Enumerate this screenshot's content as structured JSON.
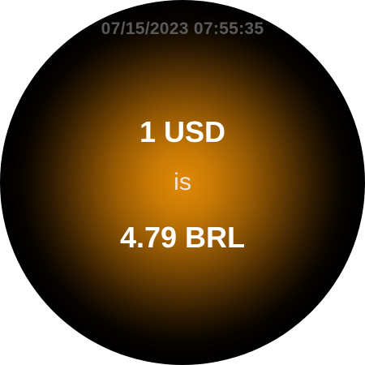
{
  "status": {
    "datetime": "07/15/2023 07:55:35"
  },
  "conversion": {
    "from": "1 USD",
    "connector": "is",
    "to": "4.79 BRL"
  },
  "colors": {
    "glow_center": "#e08a06",
    "background_edge": "#000000",
    "text_primary": "#ffffff",
    "text_timestamp": "#5a5a5a"
  }
}
